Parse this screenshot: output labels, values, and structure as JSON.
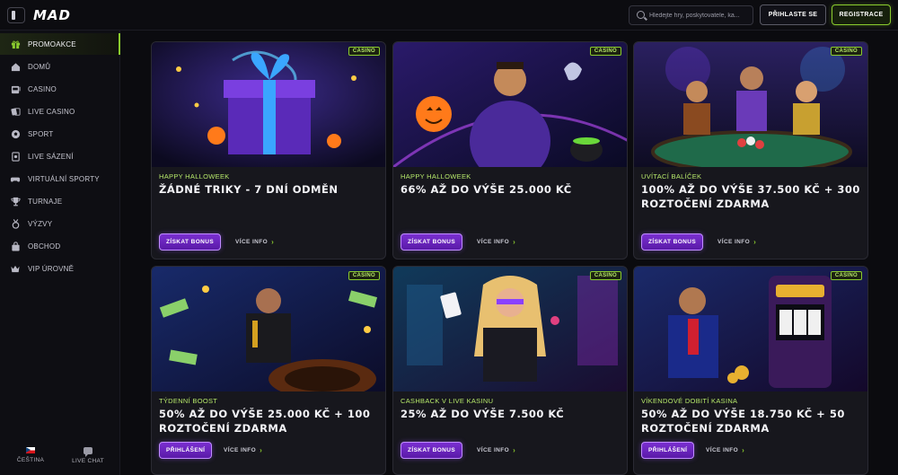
{
  "header": {
    "logo": "MAD",
    "search_placeholder": "Hledejte hry, poskytovatele, ka...",
    "login_label": "PŘIHLASTE SE",
    "register_label": "REGISTRACE"
  },
  "sidebar": {
    "items": [
      {
        "label": "PROMOAKCE",
        "icon": "gift-icon",
        "active": true
      },
      {
        "label": "DOMŮ",
        "icon": "home-icon"
      },
      {
        "label": "CASINO",
        "icon": "slot-machine-icon"
      },
      {
        "label": "LIVE CASINO",
        "icon": "cards-icon"
      },
      {
        "label": "SPORT",
        "icon": "soccer-ball-icon"
      },
      {
        "label": "LIVE SÁZENÍ",
        "icon": "live-betting-icon"
      },
      {
        "label": "VIRTUÁLNÍ SPORTY",
        "icon": "gamepad-icon"
      },
      {
        "label": "TURNAJE",
        "icon": "trophy-icon"
      },
      {
        "label": "VÝZVY",
        "icon": "medal-icon"
      },
      {
        "label": "OBCHOD",
        "icon": "shop-bag-icon"
      },
      {
        "label": "VIP ÚROVNĚ",
        "icon": "crown-icon"
      }
    ],
    "language_label": "ČEŠTINA",
    "chat_label": "LIVE CHAT"
  },
  "promos": [
    {
      "badge": "CASINO",
      "subtitle": "HAPPY HALLOWEEK",
      "title": "ŽÁDNÉ TRIKY - 7 DNÍ ODMĚN",
      "cta": "ZÍSKAT BONUS",
      "more": "VÍCE INFO"
    },
    {
      "badge": "CASINO",
      "subtitle": "HAPPY HALLOWEEK",
      "title": "66% AŽ DO VÝŠE 25.000 KČ",
      "cta": "ZÍSKAT BONUS",
      "more": "VÍCE INFO"
    },
    {
      "badge": "CASINO",
      "subtitle": "UVÍTACÍ BALÍČEK",
      "title": "100% AŽ DO VÝŠE 37.500 KČ + 300 ROZTOČENÍ ZDARMA",
      "cta": "ZÍSKAT BONUS",
      "more": "VÍCE INFO"
    },
    {
      "badge": "CASINO",
      "subtitle": "TÝDENNÍ BOOST",
      "title": "50% AŽ DO VÝŠE 25.000 KČ + 100 ROZTOČENÍ ZDARMA",
      "cta": "PŘIHLÁŠENÍ",
      "more": "VÍCE INFO"
    },
    {
      "badge": "CASINO",
      "subtitle": "CASHBACK V LIVE KASINU",
      "title": "25% AŽ DO VÝŠE 7.500 KČ",
      "cta": "ZÍSKAT BONUS",
      "more": "VÍCE INFO"
    },
    {
      "badge": "CASINO",
      "subtitle": "VÍKENDOVÉ DOBITÍ KASINA",
      "title": "50% AŽ DO VÝŠE 18.750 KČ + 50 ROZTOČENÍ ZDARMA",
      "cta": "PŘIHLÁŠENÍ",
      "more": "VÍCE INFO"
    }
  ],
  "colors": {
    "accent_green": "#8acb2e",
    "accent_purple": "#7a2fd0",
    "background": "#0b0b0f",
    "card": "#17171d"
  }
}
